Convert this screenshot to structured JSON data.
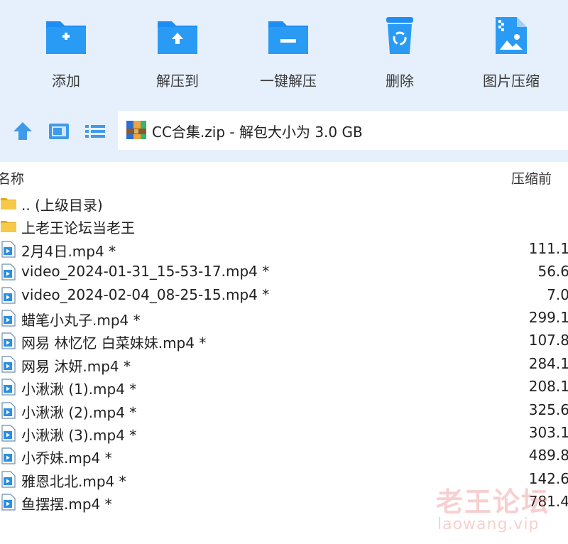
{
  "toolbar": {
    "items": [
      {
        "label": "添加",
        "icon": "folder-add-icon"
      },
      {
        "label": "解压到",
        "icon": "folder-extract-icon"
      },
      {
        "label": "一键解压",
        "icon": "folder-one-click-extract-icon"
      },
      {
        "label": "删除",
        "icon": "recycle-bin-icon"
      },
      {
        "label": "图片压缩",
        "icon": "image-compress-icon"
      }
    ]
  },
  "nav": {
    "path_text": "CC合集.zip - 解包大小为 3.0 GB"
  },
  "list": {
    "columns": {
      "name": "名称",
      "size": "压缩前"
    },
    "rows": [
      {
        "name": ".. (上级目录)",
        "size": "",
        "type": "folder"
      },
      {
        "name": "上老王论坛当老王",
        "size": "",
        "type": "folder"
      },
      {
        "name": "2月4日.mp4 *",
        "size": "111.1",
        "type": "video"
      },
      {
        "name": "video_2024-01-31_15-53-17.mp4 *",
        "size": "56.6",
        "type": "video"
      },
      {
        "name": "video_2024-02-04_08-25-15.mp4 *",
        "size": "7.0",
        "type": "video"
      },
      {
        "name": "蜡笔小丸子.mp4 *",
        "size": "299.1",
        "type": "video"
      },
      {
        "name": "网易 林忆忆 白菜妹妹.mp4 *",
        "size": "107.8",
        "type": "video"
      },
      {
        "name": "网易 沐妍.mp4 *",
        "size": "284.1",
        "type": "video"
      },
      {
        "name": "小湫湫 (1).mp4 *",
        "size": "208.1",
        "type": "video"
      },
      {
        "name": "小湫湫 (2).mp4 *",
        "size": "325.6",
        "type": "video"
      },
      {
        "name": "小湫湫 (3).mp4 *",
        "size": "303.1",
        "type": "video"
      },
      {
        "name": "小乔妹.mp4 *",
        "size": "489.8",
        "type": "video"
      },
      {
        "name": "雅恩北北.mp4 *",
        "size": "142.6",
        "type": "video"
      },
      {
        "name": "鱼摆摆.mp4 *",
        "size": "781.4",
        "type": "video"
      }
    ]
  },
  "watermark": {
    "title": "老王论坛",
    "url": "laowang.vip"
  },
  "colors": {
    "accent": "#1e8ef2",
    "toolbar_bg": "#e6f0fd",
    "folder": "#f7c948"
  }
}
